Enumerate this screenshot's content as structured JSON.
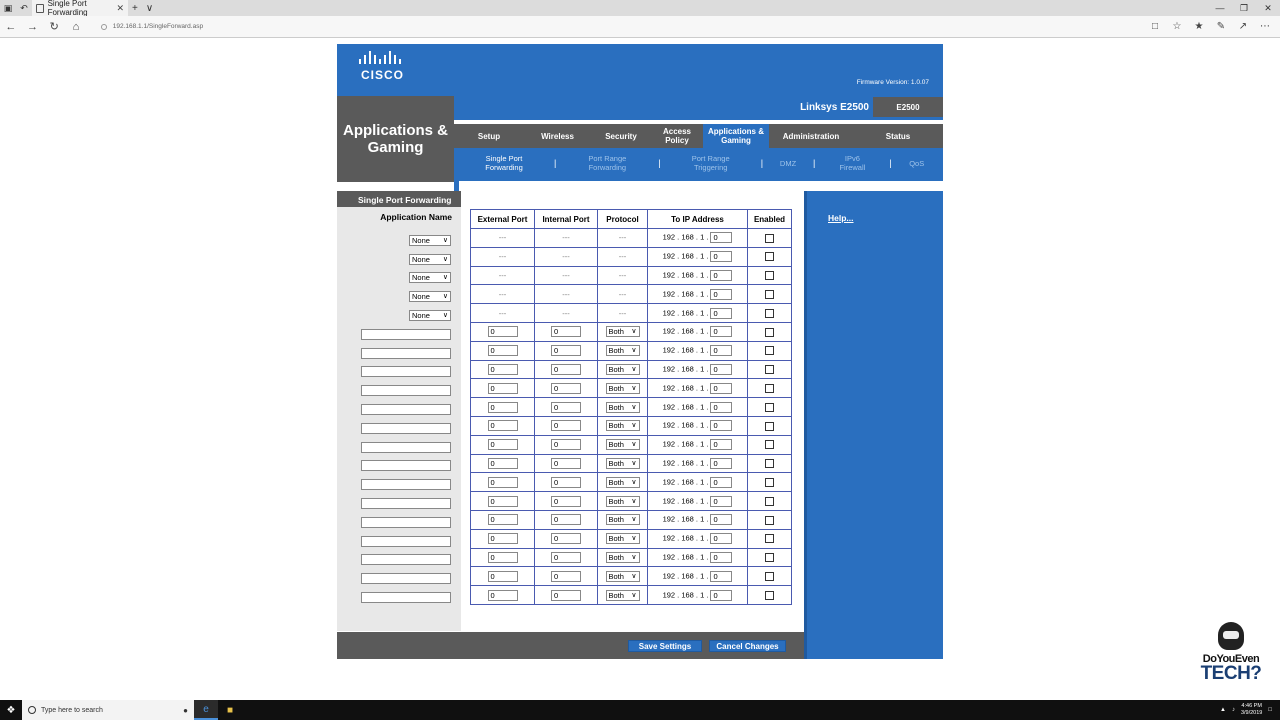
{
  "browser": {
    "tab_title": "Single Port Forwarding",
    "url": "192.168.1.1/SingleForward.asp",
    "new_tab": "+",
    "tab_menu": "∨"
  },
  "router": {
    "brand": "CISCO",
    "firmware": "Firmware Version: 1.0.07",
    "section_title_line1": "Applications &",
    "section_title_line2": "Gaming",
    "model_name": "Linksys E2500",
    "model_code": "E2500",
    "nav": [
      {
        "label": "Setup"
      },
      {
        "label": "Wireless"
      },
      {
        "label": "Security"
      },
      {
        "label": "Access Policy"
      },
      {
        "label": "Applications & Gaming"
      },
      {
        "label": "Administration"
      },
      {
        "label": "Status"
      }
    ],
    "subnav": [
      {
        "label": "Single Port Forwarding"
      },
      {
        "label": "Port Range Forwarding"
      },
      {
        "label": "Port Range Triggering"
      },
      {
        "label": "DMZ"
      },
      {
        "label": "IPv6 Firewall"
      },
      {
        "label": "QoS"
      }
    ],
    "subnav_sep": "|",
    "left_title": "Single Port Forwarding",
    "left_subtitle": "Application Name",
    "help": "Help...",
    "save_button": "Save Settings",
    "cancel_button": "Cancel Changes",
    "table": {
      "headers": [
        "External Port",
        "Internal Port",
        "Protocol",
        "To IP Address",
        "Enabled"
      ],
      "preset_app_value": "None",
      "preset_cell": "---",
      "ip_prefix": "192 . 168 . 1 .",
      "ip_last": "0",
      "port_default": "0",
      "protocol_default": "Both",
      "preset_rows": 5,
      "custom_rows": 15
    }
  },
  "taskbar": {
    "search_placeholder": "Type here to search",
    "time": "4:46 PM",
    "date": "3/9/2019"
  },
  "watermark": {
    "line1": "DoYouEven",
    "line2": "TECH?"
  }
}
